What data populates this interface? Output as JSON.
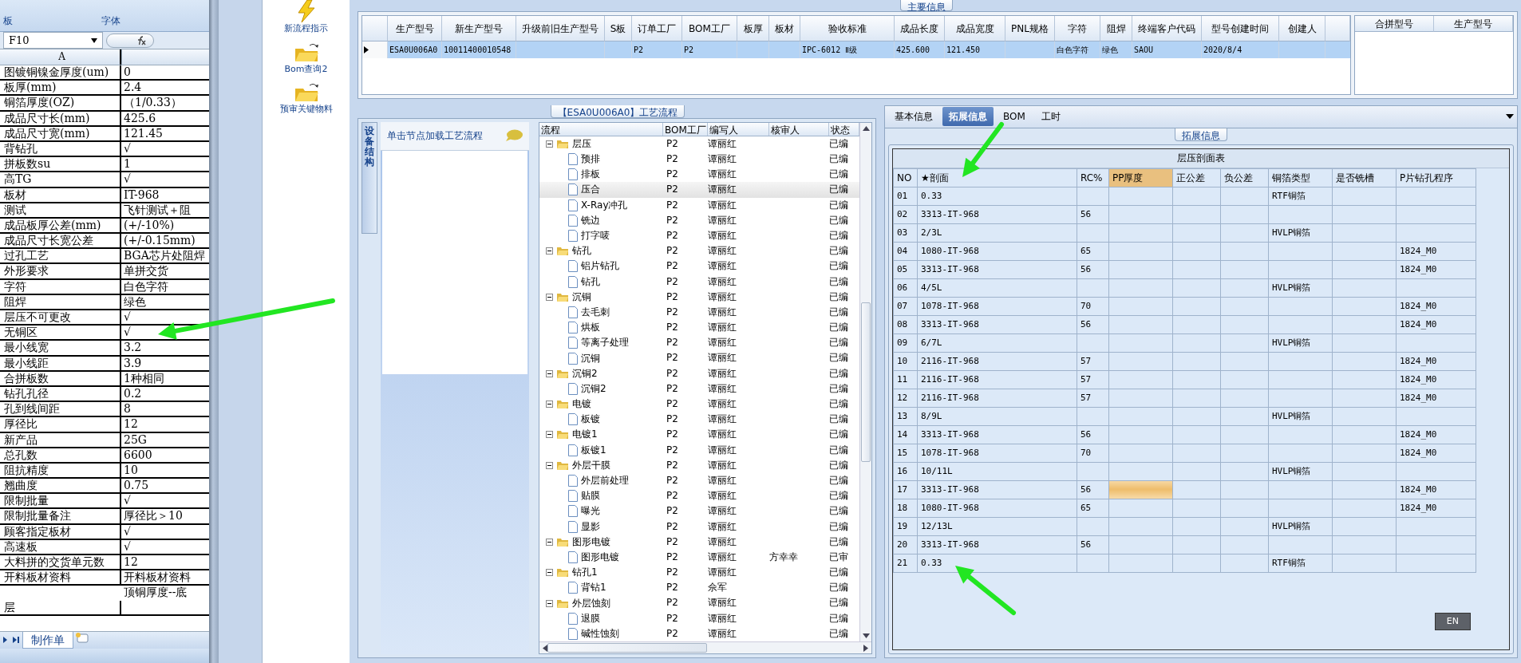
{
  "spreadsheet": {
    "ribbon_groups": [
      "板",
      "字体"
    ],
    "name_box": "F10",
    "column_header": "A",
    "rows": [
      {
        "label": "图镀铜镍金厚度(um)",
        "value": "0"
      },
      {
        "label": "板厚(mm)",
        "value": "2.4"
      },
      {
        "label": "铜箔厚度(OZ)",
        "value": "（1/0.33）"
      },
      {
        "label": "成品尺寸长(mm)",
        "value": "425.6"
      },
      {
        "label": "成品尺寸宽(mm)",
        "value": "121.45"
      },
      {
        "label": "背钻孔",
        "value": "√"
      },
      {
        "label": "拼板数su",
        "value": "1"
      },
      {
        "label": "高TG",
        "value": "√"
      },
      {
        "label": "板材",
        "value": "IT-968"
      },
      {
        "label": "测试",
        "value": "飞针测试＋阻"
      },
      {
        "label": "成品板厚公差(mm)",
        "value": "(+/-10%)"
      },
      {
        "label": "成品尺寸长宽公差",
        "value": "(+/-0.15mm)"
      },
      {
        "label": "过孔工艺",
        "value": "BGA芯片处阻焊"
      },
      {
        "label": "外形要求",
        "value": "单拼交货"
      },
      {
        "label": "字符",
        "value": "白色字符"
      },
      {
        "label": "阻焊",
        "value": "绿色"
      },
      {
        "label": "层压不可更改",
        "value": "√"
      },
      {
        "label": "无铜区",
        "value": "√"
      },
      {
        "label": "最小线宽",
        "value": "3.2"
      },
      {
        "label": "最小线距",
        "value": "3.9"
      },
      {
        "label": "合拼板数",
        "value": "1种相同"
      },
      {
        "label": "钻孔孔径",
        "value": "0.2"
      },
      {
        "label": "孔到线间距",
        "value": "8"
      },
      {
        "label": "厚径比",
        "value": "12"
      },
      {
        "label": "新产品",
        "value": "25G"
      },
      {
        "label": "总孔数",
        "value": "6600"
      },
      {
        "label": "阻抗精度",
        "value": "10"
      },
      {
        "label": "翘曲度",
        "value": "0.75"
      },
      {
        "label": "限制批量",
        "value": "√"
      },
      {
        "label": "限制批量备注",
        "value": "厚径比＞10"
      },
      {
        "label": "顾客指定板材",
        "value": "√"
      },
      {
        "label": "高速板",
        "value": "√"
      },
      {
        "label": "大料拼的交货单元数",
        "value": "12"
      },
      {
        "label": "开料板材资料",
        "value": "开料板材资料"
      },
      {
        "label": "层",
        "value": "顶铜厚度--底",
        "kind": "tall"
      }
    ],
    "sheet_tab": "制作单"
  },
  "toolbox": {
    "items": [
      {
        "label": "新流程指示",
        "kind": "flash"
      },
      {
        "label": "Bom查询2",
        "kind": "folder"
      },
      {
        "label": "预审关键物料",
        "kind": "folder"
      }
    ]
  },
  "main_info": {
    "title": "主要信息",
    "columns": [
      "生产型号",
      "新生产型号",
      "升级前旧生产型号",
      "S板",
      "订单工厂",
      "BOM工厂",
      "板厚",
      "板材",
      "验收标准",
      "成品长度",
      "成品宽度",
      "PNL规格",
      "字符",
      "阻焊",
      "终端客户代码",
      "型号创建时间",
      "创建人"
    ],
    "rows": [
      {
        "selected": true,
        "cells": [
          "ESA0U006A0",
          "10011400010548",
          null,
          null,
          "P2",
          "P2",
          null,
          null,
          "IPC-6012 Ⅱ级",
          "425.600",
          "121.450",
          null,
          "白色字符",
          "绿色",
          "SAOU",
          "2020/8/4",
          null
        ]
      }
    ],
    "side_columns": [
      "合拼型号",
      "生产型号"
    ]
  },
  "process": {
    "title": "【ESA0U006A0】工艺流程",
    "side_tab": "设备结构",
    "hint": "单击节点加载工艺流程",
    "columns": [
      "流程",
      "BOM工厂",
      "编写人",
      "核审人",
      "状态"
    ],
    "tree": [
      {
        "name": "层压",
        "bom": "P2",
        "writer": "谭丽红",
        "status": "已编",
        "selected": false,
        "expanded": true,
        "children": [
          {
            "name": "预排",
            "bom": "P2",
            "writer": "谭丽红",
            "status": "已编",
            "selected": false
          },
          {
            "name": "排板",
            "bom": "P2",
            "writer": "谭丽红",
            "status": "已编",
            "selected": false
          },
          {
            "name": "压合",
            "bom": "P2",
            "writer": "谭丽红",
            "status": "已编",
            "selected": true
          },
          {
            "name": "X-Ray冲孔",
            "bom": "P2",
            "writer": "谭丽红",
            "status": "已编",
            "selected": false
          },
          {
            "name": "铣边",
            "bom": "P2",
            "writer": "谭丽红",
            "status": "已编",
            "selected": false
          },
          {
            "name": "打字唛",
            "bom": "P2",
            "writer": "谭丽红",
            "status": "已编",
            "selected": false
          }
        ]
      },
      {
        "name": "钻孔",
        "bom": "P2",
        "writer": "谭丽红",
        "status": "已编",
        "selected": false,
        "expanded": true,
        "children": [
          {
            "name": "铝片钻孔",
            "bom": "P2",
            "writer": "谭丽红",
            "status": "已编",
            "selected": false
          },
          {
            "name": "钻孔",
            "bom": "P2",
            "writer": "谭丽红",
            "status": "已编",
            "selected": false
          }
        ]
      },
      {
        "name": "沉铜",
        "bom": "P2",
        "writer": "谭丽红",
        "status": "已编",
        "selected": false,
        "expanded": true,
        "children": [
          {
            "name": "去毛刺",
            "bom": "P2",
            "writer": "谭丽红",
            "status": "已编",
            "selected": false
          },
          {
            "name": "烘板",
            "bom": "P2",
            "writer": "谭丽红",
            "status": "已编",
            "selected": false
          },
          {
            "name": "等离子处理",
            "bom": "P2",
            "writer": "谭丽红",
            "status": "已编",
            "selected": false
          },
          {
            "name": "沉铜",
            "bom": "P2",
            "writer": "谭丽红",
            "status": "已编",
            "selected": false
          }
        ]
      },
      {
        "name": "沉铜2",
        "bom": "P2",
        "writer": "谭丽红",
        "status": "已编",
        "selected": false,
        "expanded": true,
        "children": [
          {
            "name": "沉铜2",
            "bom": "P2",
            "writer": "谭丽红",
            "status": "已编",
            "selected": false
          }
        ]
      },
      {
        "name": "电镀",
        "bom": "P2",
        "writer": "谭丽红",
        "status": "已编",
        "selected": false,
        "expanded": true,
        "children": [
          {
            "name": "板镀",
            "bom": "P2",
            "writer": "谭丽红",
            "status": "已编",
            "selected": false
          }
        ]
      },
      {
        "name": "电镀1",
        "bom": "P2",
        "writer": "谭丽红",
        "status": "已编",
        "selected": false,
        "expanded": true,
        "children": [
          {
            "name": "板镀1",
            "bom": "P2",
            "writer": "谭丽红",
            "status": "已编",
            "selected": false
          }
        ]
      },
      {
        "name": "外层干膜",
        "bom": "P2",
        "writer": "谭丽红",
        "status": "已编",
        "selected": false,
        "expanded": true,
        "children": [
          {
            "name": "外层前处理",
            "bom": "P2",
            "writer": "谭丽红",
            "status": "已编",
            "selected": false
          },
          {
            "name": "贴膜",
            "bom": "P2",
            "writer": "谭丽红",
            "status": "已编",
            "selected": false
          },
          {
            "name": "曝光",
            "bom": "P2",
            "writer": "谭丽红",
            "status": "已编",
            "selected": false
          },
          {
            "name": "显影",
            "bom": "P2",
            "writer": "谭丽红",
            "status": "已编",
            "selected": false
          }
        ]
      },
      {
        "name": "图形电镀",
        "bom": "P2",
        "writer": "谭丽红",
        "status": "已编",
        "selected": false,
        "expanded": true,
        "children": [
          {
            "name": "图形电镀",
            "bom": "P2",
            "writer": "谭丽红",
            "reviewer": "方幸幸",
            "status": "已审",
            "selected": false
          }
        ]
      },
      {
        "name": "钻孔1",
        "bom": "P2",
        "writer": "谭丽红",
        "status": "已编",
        "selected": false,
        "expanded": true,
        "children": [
          {
            "name": "背钻1",
            "bom": "P2",
            "writer": "佘军",
            "status": "已编",
            "selected": false
          }
        ]
      },
      {
        "name": "外层蚀刻",
        "bom": "P2",
        "writer": "谭丽红",
        "status": "已编",
        "selected": false,
        "expanded": true,
        "children": [
          {
            "name": "退膜",
            "bom": "P2",
            "writer": "谭丽红",
            "status": "已编",
            "selected": false
          },
          {
            "name": "碱性蚀刻",
            "bom": "P2",
            "writer": "谭丽红",
            "status": "已编",
            "selected": false
          }
        ]
      }
    ]
  },
  "details": {
    "tabs": [
      {
        "label": "基本信息",
        "selected": false
      },
      {
        "label": "拓展信息",
        "selected": true
      },
      {
        "label": "BOM",
        "selected": false
      },
      {
        "label": "工时",
        "selected": false
      }
    ],
    "group_title": "拓展信息",
    "table_title": "层压剖面表",
    "columns": [
      {
        "label": "NO",
        "highlighted": false
      },
      {
        "label": "★剖面",
        "highlighted": false
      },
      {
        "label": "RC%",
        "highlighted": false
      },
      {
        "label": "PP厚度",
        "highlighted": true
      },
      {
        "label": "正公差",
        "highlighted": false
      },
      {
        "label": "负公差",
        "highlighted": false
      },
      {
        "label": "铜箔类型",
        "highlighted": false
      },
      {
        "label": "是否铣槽",
        "highlighted": false
      },
      {
        "label": "P片钻孔程序",
        "highlighted": false
      }
    ],
    "rows": [
      {
        "focused": false,
        "cells": [
          "01",
          "0.33",
          null,
          null,
          null,
          null,
          "RTF铜箔",
          null,
          null
        ]
      },
      {
        "focused": false,
        "cells": [
          "02",
          "3313-IT-968",
          "56",
          null,
          null,
          null,
          null,
          null,
          null
        ]
      },
      {
        "focused": false,
        "cells": [
          "03",
          "2/3L",
          null,
          null,
          null,
          null,
          "HVLP铜箔",
          null,
          null
        ]
      },
      {
        "focused": false,
        "cells": [
          "04",
          "1080-IT-968",
          "65",
          null,
          null,
          null,
          null,
          null,
          "1824_M0"
        ]
      },
      {
        "focused": false,
        "cells": [
          "05",
          "3313-IT-968",
          "56",
          null,
          null,
          null,
          null,
          null,
          "1824_M0"
        ]
      },
      {
        "focused": false,
        "cells": [
          "06",
          "4/5L",
          null,
          null,
          null,
          null,
          "HVLP铜箔",
          null,
          null
        ]
      },
      {
        "focused": false,
        "cells": [
          "07",
          "1078-IT-968",
          "70",
          null,
          null,
          null,
          null,
          null,
          "1824_M0"
        ]
      },
      {
        "focused": false,
        "cells": [
          "08",
          "3313-IT-968",
          "56",
          null,
          null,
          null,
          null,
          null,
          "1824_M0"
        ]
      },
      {
        "focused": false,
        "cells": [
          "09",
          "6/7L",
          null,
          null,
          null,
          null,
          "HVLP铜箔",
          null,
          null
        ]
      },
      {
        "focused": false,
        "cells": [
          "10",
          "2116-IT-968",
          "57",
          null,
          null,
          null,
          null,
          null,
          "1824_M0"
        ]
      },
      {
        "focused": false,
        "cells": [
          "11",
          "2116-IT-968",
          "57",
          null,
          null,
          null,
          null,
          null,
          "1824_M0"
        ]
      },
      {
        "focused": false,
        "cells": [
          "12",
          "2116-IT-968",
          "57",
          null,
          null,
          null,
          null,
          null,
          "1824_M0"
        ]
      },
      {
        "focused": false,
        "cells": [
          "13",
          "8/9L",
          null,
          null,
          null,
          null,
          "HVLP铜箔",
          null,
          null
        ]
      },
      {
        "focused": false,
        "cells": [
          "14",
          "3313-IT-968",
          "56",
          null,
          null,
          null,
          null,
          null,
          "1824_M0"
        ]
      },
      {
        "focused": false,
        "cells": [
          "15",
          "1078-IT-968",
          "70",
          null,
          null,
          null,
          null,
          null,
          "1824_M0"
        ]
      },
      {
        "focused": false,
        "cells": [
          "16",
          "10/11L",
          null,
          null,
          null,
          null,
          "HVLP铜箔",
          null,
          null
        ]
      },
      {
        "focused": true,
        "cells": [
          "17",
          "3313-IT-968",
          "56",
          null,
          null,
          null,
          null,
          null,
          "1824_M0"
        ]
      },
      {
        "focused": false,
        "cells": [
          "18",
          "1080-IT-968",
          "65",
          null,
          null,
          null,
          null,
          null,
          "1824_M0"
        ]
      },
      {
        "focused": false,
        "cells": [
          "19",
          "12/13L",
          null,
          null,
          null,
          null,
          "HVLP铜箔",
          null,
          null
        ]
      },
      {
        "focused": false,
        "cells": [
          "20",
          "3313-IT-968",
          "56",
          null,
          null,
          null,
          null,
          null,
          null
        ]
      },
      {
        "focused": false,
        "cells": [
          "21",
          "0.33",
          null,
          null,
          null,
          null,
          "RTF铜箔",
          null,
          null
        ]
      }
    ],
    "ime": "EN"
  }
}
